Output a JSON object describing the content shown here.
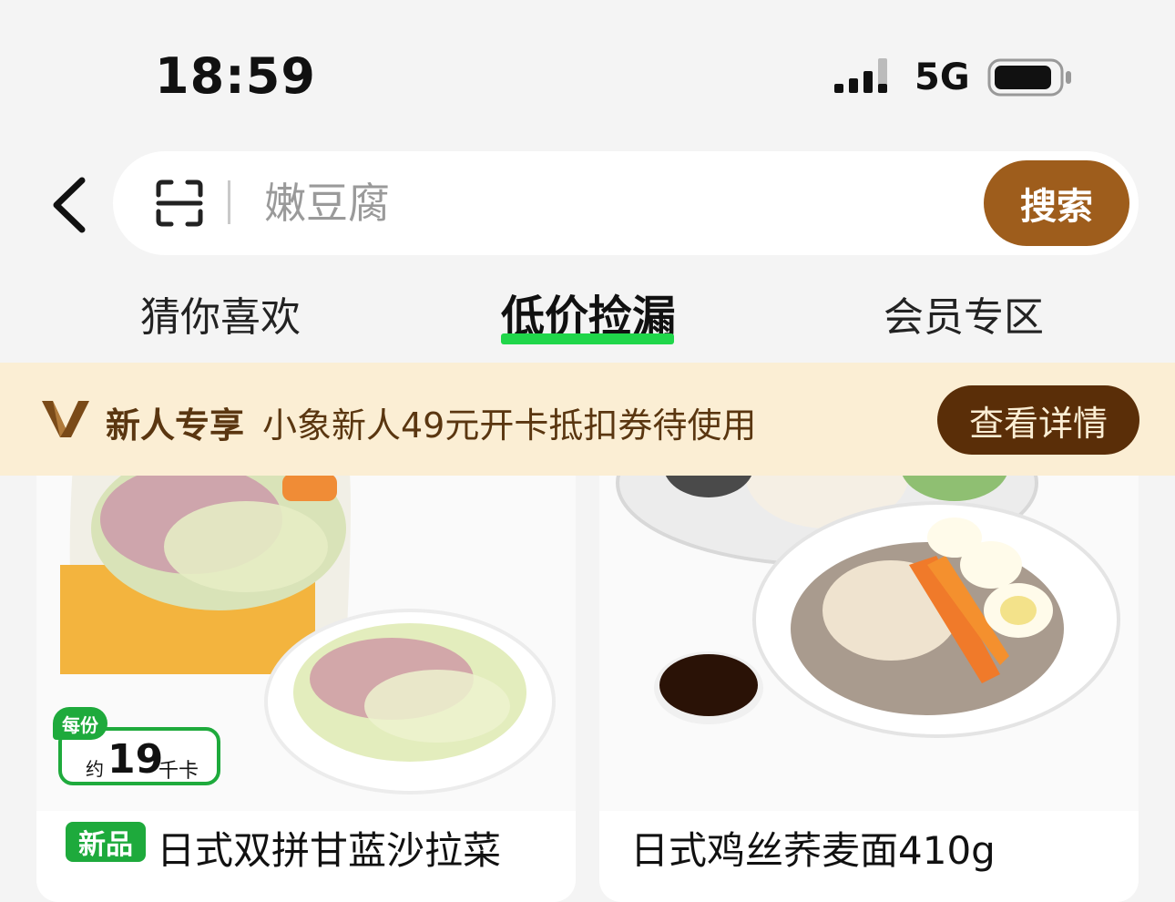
{
  "status_bar": {
    "time": "18:59",
    "network": "5G"
  },
  "search": {
    "placeholder": "嫩豆腐",
    "button_label": "搜索"
  },
  "tabs": [
    {
      "label": "猜你喜欢",
      "active": false
    },
    {
      "label": "低价捡漏",
      "active": true
    },
    {
      "label": "会员专区",
      "active": false
    }
  ],
  "promo": {
    "title": "新人专享",
    "text": "小象新人49元开卡抵扣券待使用",
    "button_label": "查看详情"
  },
  "products": [
    {
      "badge": "新品",
      "name": "日式双拼甘蓝沙拉菜",
      "calorie": {
        "label": "每份",
        "prefix": "约",
        "value": "19",
        "unit": "千卡"
      }
    },
    {
      "name": "日式鸡丝荞麦面410g"
    }
  ],
  "colors": {
    "accent": "#9e5d1c",
    "tab_underline": "#20d64a",
    "badge_green": "#1eaa3c",
    "banner_bg": "#fbeed4"
  }
}
